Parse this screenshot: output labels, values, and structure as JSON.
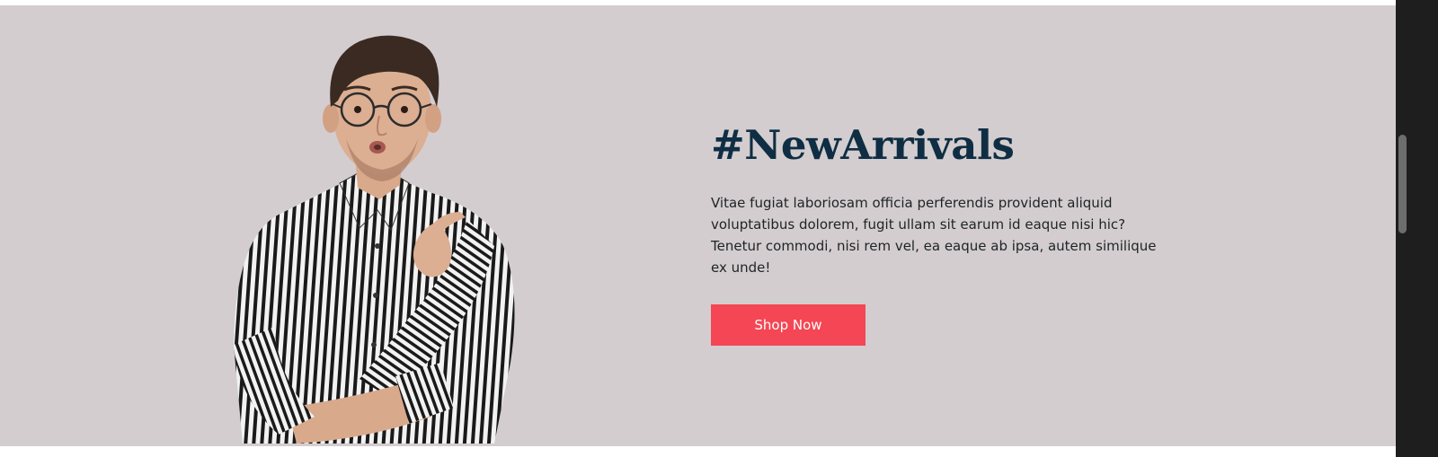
{
  "hero": {
    "headline": "#NewArrivals",
    "description": "Vitae fugiat laboriosam officia perferendis provident aliquid voluptatibus dolorem, fugit ullam sit earum id eaque nisi hic? Tenetur commodi, nisi rem vel, ea eaque ab ipsa, autem similique ex unde!",
    "cta_label": "Shop Now",
    "image_subject": "man-in-striped-shirt-pointing-up"
  },
  "colors": {
    "hero_background": "#d3cdcf",
    "headline": "#0f2e43",
    "body_text": "#1f2326",
    "cta_background": "#f44654",
    "cta_text": "#ffffff",
    "scrollbar_track": "#1e1e1e",
    "scrollbar_thumb": "#6d6d6d"
  }
}
